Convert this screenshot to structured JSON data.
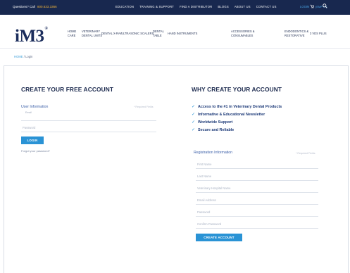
{
  "topbar": {
    "question": "Questions? Call",
    "phone": "800.633.3366",
    "nav": [
      "EDUCATION",
      "TRAINING & SUPPORT",
      "FIND A DISTRIBUTOR",
      "BLOGS",
      "ABOUT US",
      "CONTACT US"
    ],
    "login": "LOGIN",
    "cart": "CART",
    "cart_state": "(EMPTY)"
  },
  "logo": {
    "text": "iM3",
    "reg": "®"
  },
  "mainnav": [
    {
      "line1": "HOME",
      "line2": "CARE"
    },
    {
      "line1": "VETERINARY",
      "line2": "DENTAL UNITS"
    },
    {
      "line1": "DENTAL X-RAY",
      "line2": ""
    },
    {
      "line1": "ULTRASONIC SCALERS",
      "line2": ""
    },
    {
      "line1": "DENTAL",
      "line2": "TABLE"
    },
    {
      "line1": "HAND INSTRUMENTS",
      "line2": ""
    },
    {
      "line1": "ACCESSORIES &",
      "line2": "CONSUMABLES"
    },
    {
      "line1": "ENDODONTICS &",
      "line2": "RESTORATIVE"
    },
    {
      "line1": "3 VDS PLUS",
      "line2": ""
    }
  ],
  "breadcrumb": {
    "home": "HOME",
    "sep": "/",
    "current": "Login"
  },
  "left": {
    "title": "CREATE YOUR FREE ACCOUNT",
    "section": "User Information",
    "required": "* Required Fields",
    "user_label": "Email",
    "pass_placeholder": "Password",
    "login_button": "LOGIN",
    "forgot": "Forgot your password?"
  },
  "right": {
    "title": "WHY CREATE YOUR ACCOUNT",
    "benefits": [
      "Access to the #1 in Veterinary Dental Products",
      "Informative & Educational Newsletter",
      "Worldwide Support",
      "Secure and Reliable"
    ],
    "section": "Registration Information",
    "required": "* Required Fields",
    "fields": [
      "First Name",
      "Last Name",
      "Veterinary Hospital Name",
      "Email Address",
      "Password",
      "Confirm Password"
    ],
    "create_button": "CREATE ACCOUNT"
  },
  "colors": {
    "navy": "#18284f",
    "accent": "#2a93d5",
    "link": "#3b9ed9"
  }
}
